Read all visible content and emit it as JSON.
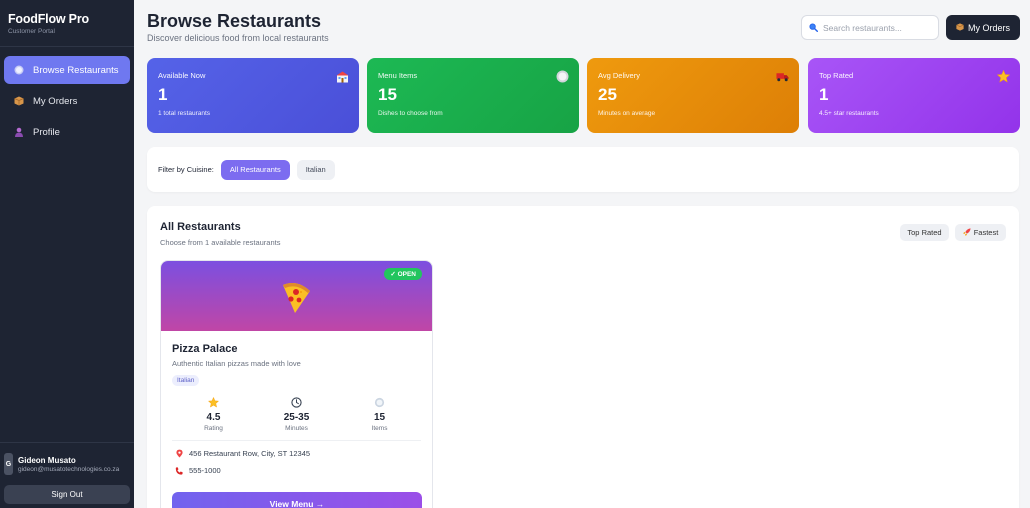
{
  "sidebar": {
    "brand_title": "FoodFlow Pro",
    "brand_subtitle": "Customer Portal",
    "items": [
      {
        "label": "Browse Restaurants",
        "icon": "plate-icon",
        "active": true
      },
      {
        "label": "My Orders",
        "icon": "package-icon",
        "active": false
      },
      {
        "label": "Profile",
        "icon": "user-icon",
        "active": false
      }
    ],
    "user": {
      "initial": "G",
      "name": "Gideon Musato",
      "email": "gideon@musatotechnologies.co.za"
    },
    "signout_label": "Sign Out"
  },
  "header": {
    "title": "Browse Restaurants",
    "subtitle": "Discover delicious food from local restaurants",
    "search_placeholder": "Search restaurants...",
    "my_orders_label": "My Orders"
  },
  "stats": [
    {
      "label": "Available Now",
      "value": "1",
      "desc": "1 total restaurants",
      "icon": "restaurant-icon",
      "color": "#5563e8"
    },
    {
      "label": "Menu Items",
      "value": "15",
      "desc": "Dishes to choose from",
      "icon": "plate-icon",
      "color": "#1db954"
    },
    {
      "label": "Avg Delivery",
      "value": "25",
      "desc": "Minutes on average",
      "icon": "delivery-truck-icon",
      "color": "#ef9a0e"
    },
    {
      "label": "Top Rated",
      "value": "1",
      "desc": "4.5+ star restaurants",
      "icon": "star-icon",
      "color": "#a855f7"
    }
  ],
  "filter": {
    "label": "Filter by Cuisine:",
    "chips": [
      {
        "label": "All Restaurants",
        "active": true
      },
      {
        "label": "Italian",
        "active": false
      }
    ]
  },
  "restaurants_panel": {
    "title": "All Restaurants",
    "subtitle": "Choose from 1 available restaurants",
    "sort_top_rated": "Top Rated",
    "sort_fastest": "Fastest"
  },
  "restaurant": {
    "status": "✓ OPEN",
    "name": "Pizza Palace",
    "description": "Authentic Italian pizzas made with love",
    "cuisine": "Italian",
    "rating": "4.5",
    "rating_label": "Rating",
    "time": "25-35",
    "time_label": "Minutes",
    "items": "15",
    "items_label": "Items",
    "address": "456 Restaurant Row, City, ST 12345",
    "phone": "555-1000",
    "view_menu_label": "View Menu →"
  },
  "colors": {
    "sidebar_bg": "#1e2433",
    "accent": "#6f78f0",
    "open_badge": "#22c55e"
  }
}
